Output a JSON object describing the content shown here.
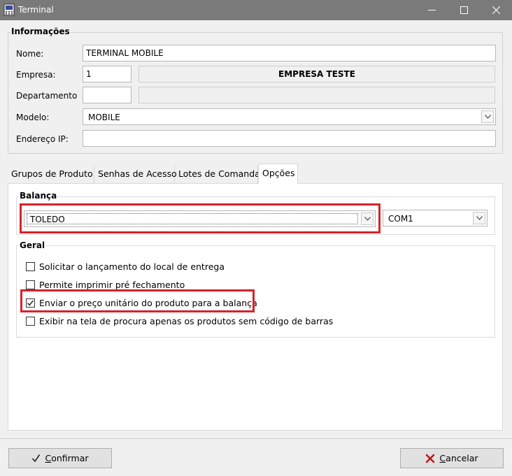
{
  "window": {
    "title": "Terminal"
  },
  "info": {
    "title": "Informações",
    "nome": {
      "label": "Nome:",
      "value": "TERMINAL MOBILE"
    },
    "empresa": {
      "label": "Empresa:",
      "code": "1",
      "name": "EMPRESA TESTE"
    },
    "departamento": {
      "label": "Departamento",
      "code": "",
      "name": ""
    },
    "modelo": {
      "label": "Modelo:",
      "value": "MOBILE"
    },
    "ip": {
      "label": "Endereço IP:",
      "value": ""
    }
  },
  "tabs": [
    {
      "label": "Grupos de Produto"
    },
    {
      "label": "Senhas de Acesso"
    },
    {
      "label": "Lotes de Comanda"
    },
    {
      "label": "Opções"
    }
  ],
  "balanca": {
    "title": "Balança",
    "model": "TOLEDO",
    "port": "COM1"
  },
  "geral": {
    "title": "Geral",
    "options": [
      {
        "label": "Solicitar o lançamento do local de entrega",
        "checked": false
      },
      {
        "label": "Permite imprimir pré fechamento",
        "checked": false
      },
      {
        "label": "Enviar o preço unitário do produto para a balança",
        "checked": true
      },
      {
        "label": "Exibir na tela de procura apenas os produtos sem código de barras",
        "checked": false
      }
    ]
  },
  "buttons": {
    "confirm": {
      "label": "Confirmar",
      "mnemonic": "C",
      "rest": "onfirmar"
    },
    "cancel": {
      "label": "Cancelar",
      "mnemonic": "C",
      "rest": "ancelar"
    }
  },
  "colors": {
    "highlight": "#d7222b",
    "titlebar": "#7a7a7a"
  }
}
